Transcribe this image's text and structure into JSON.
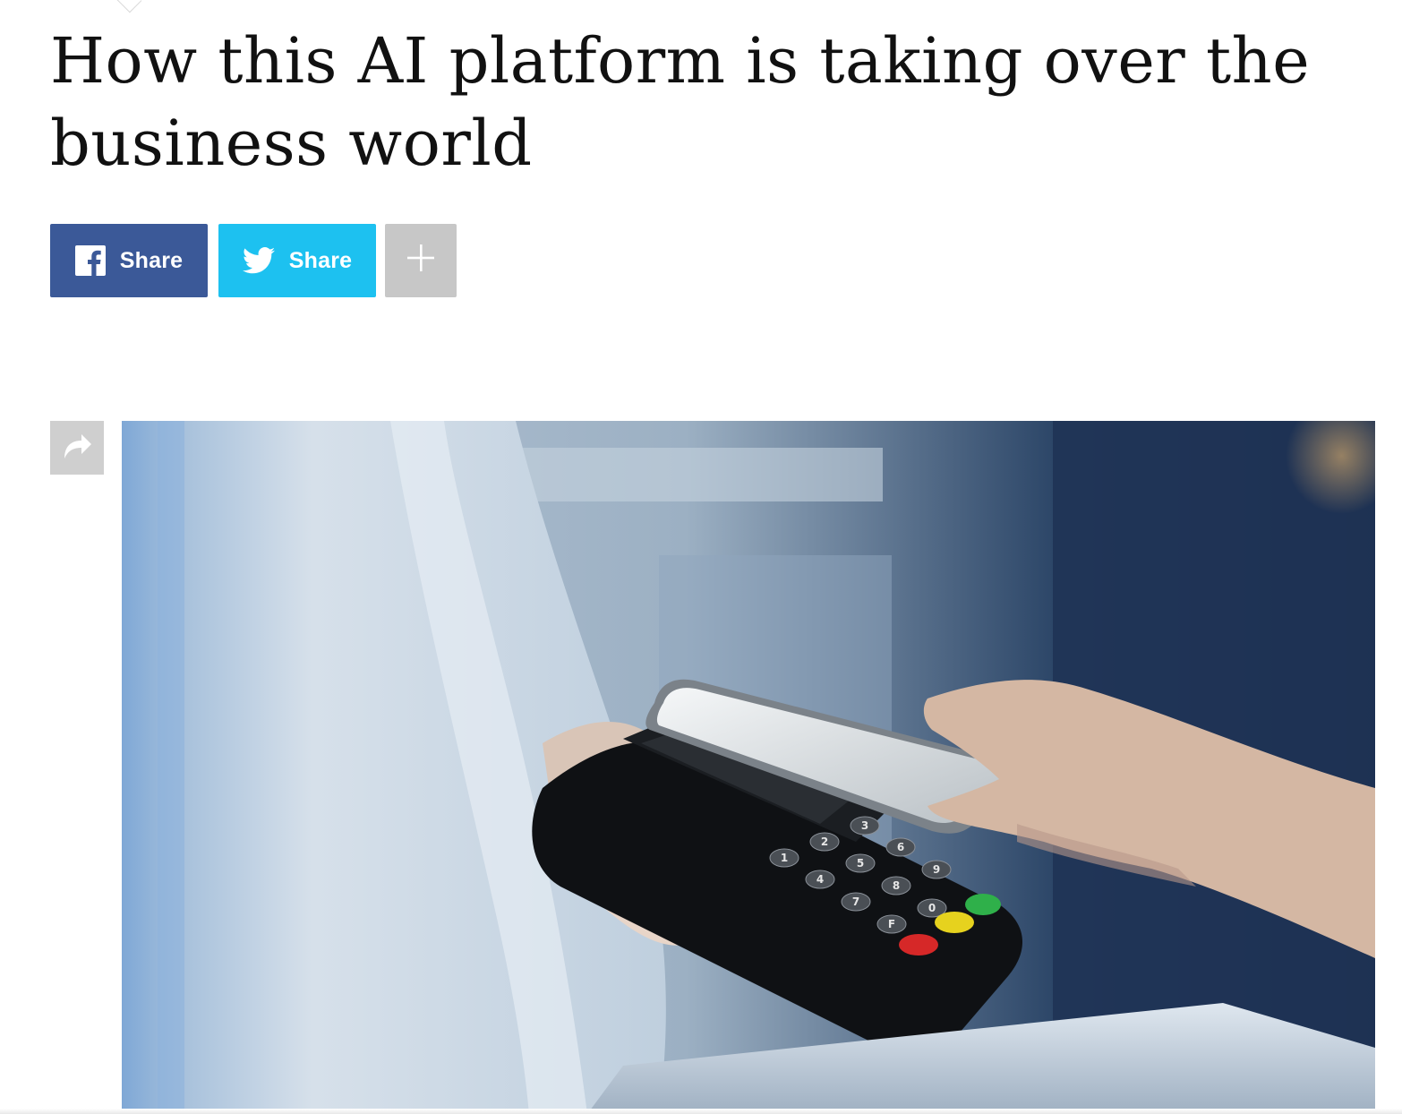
{
  "article": {
    "headline": "How this AI platform is taking over the business world"
  },
  "share_bar": {
    "facebook_label": "Share",
    "twitter_label": "Share",
    "more_label": "+"
  },
  "keypad": {
    "keys": [
      "1",
      "2",
      "3",
      "4",
      "5",
      "6",
      "7",
      "8",
      "9",
      "F",
      "0"
    ]
  },
  "icons": {
    "facebook": "facebook-icon",
    "twitter": "twitter-icon",
    "plus": "plus-icon",
    "share_arrow": "share-arrow-icon"
  },
  "colors": {
    "facebook": "#3b5998",
    "twitter": "#1dc1f0",
    "more": "#c7c7c7",
    "image_share": "#cfcfcf"
  }
}
